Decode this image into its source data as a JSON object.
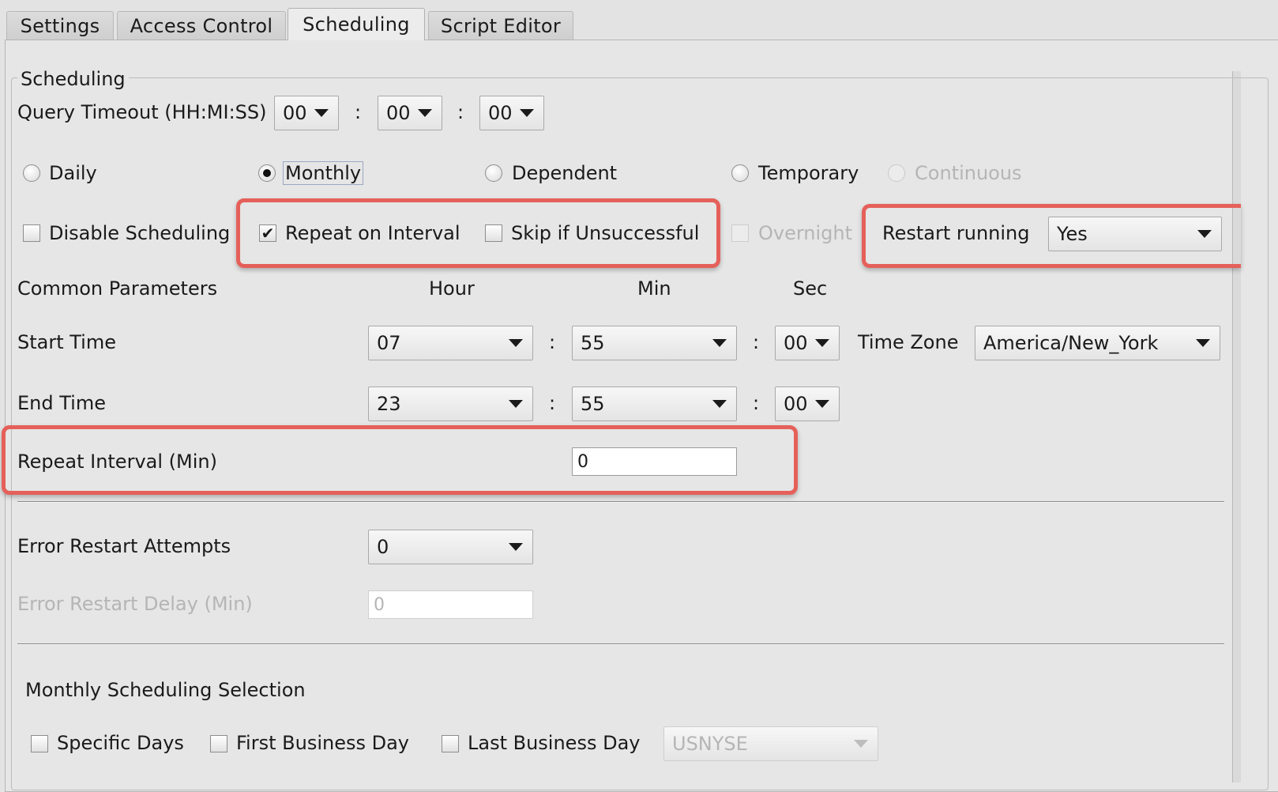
{
  "tabs": [
    {
      "label": "Settings"
    },
    {
      "label": "Access Control"
    },
    {
      "label": "Scheduling",
      "active": true
    },
    {
      "label": "Script Editor"
    }
  ],
  "scheduling": {
    "legend": "Scheduling",
    "query_timeout": {
      "label": "Query Timeout (HH:MI:SS)",
      "hh": "00",
      "mi": "00",
      "ss": "00",
      "sep": ":"
    },
    "radios": {
      "daily": "Daily",
      "monthly": "Monthly",
      "dependent": "Dependent",
      "temporary": "Temporary",
      "continuous": "Continuous",
      "selected": "Monthly"
    },
    "checks": {
      "disable_scheduling": "Disable Scheduling",
      "repeat_on_interval": "Repeat on Interval",
      "skip_if_unsuccessful": "Skip if Unsuccessful",
      "overnight": "Overnight",
      "repeat_checked": true
    },
    "restart_running": {
      "label": "Restart running",
      "value": "Yes"
    },
    "common_parameters": {
      "label": "Common Parameters",
      "hour": "Hour",
      "min": "Min",
      "sec": "Sec"
    },
    "start_time": {
      "label": "Start Time",
      "hour": "07",
      "min": "55",
      "sec": "00"
    },
    "time_zone": {
      "label": "Time Zone",
      "value": "America/New_York"
    },
    "end_time": {
      "label": "End Time",
      "hour": "23",
      "min": "55",
      "sec": "00"
    },
    "repeat_interval": {
      "label": "Repeat Interval (Min)",
      "value": "0"
    },
    "error_restart_attempts": {
      "label": "Error Restart Attempts",
      "value": "0"
    },
    "error_restart_delay": {
      "label": "Error Restart Delay (Min)",
      "value": "0"
    },
    "monthly": {
      "title": "Monthly Scheduling Selection",
      "specific_days": "Specific Days",
      "first_business_day": "First Business Day",
      "last_business_day": "Last Business Day",
      "calendar": "USNYSE"
    }
  },
  "colors": {
    "highlight": "#e5605a",
    "panel": "#e6e6e6",
    "disabled_text": "#b5b5b5"
  }
}
